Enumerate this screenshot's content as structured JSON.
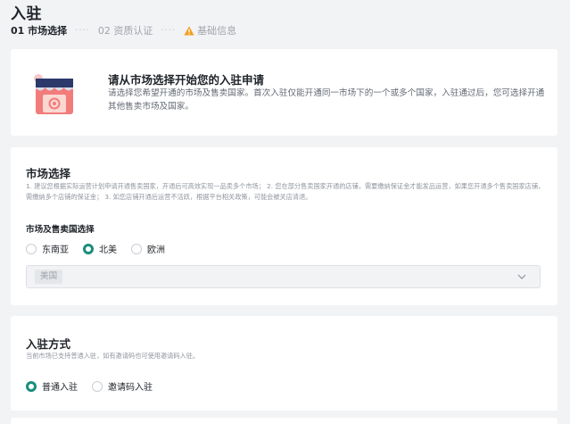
{
  "page": {
    "title": "入驻"
  },
  "steps": {
    "step1": "01 市场选择",
    "dots": "····",
    "step2": "02 资质认证",
    "step3": "基础信息"
  },
  "intro": {
    "icon": "shop-icon",
    "title": "请从市场选择开始您的入驻申请",
    "description": "请选择您希望开通的市场及售卖国家。首次入驻仅能开通同一市场下的一个或多个国家，入驻通过后，您可选择开通其他售卖市场及国家。"
  },
  "market": {
    "title": "市场选择",
    "description": "1. 建议您根据实际运营计划申请开通售卖国家，开通后可高效实现一品卖多个市场；  2. 您在部分售卖国家开通的店铺，需要缴纳保证金才能发品运营，如果您开通多个售卖国家店铺，需缴纳多个店铺的保证金；  3. 如您店铺开通后运营不活跃，根据平台相关政策，可能会被关店清退。",
    "field_label": "市场及售卖国选择",
    "options": [
      "东南亚",
      "北美",
      "欧洲"
    ],
    "selected_option": "北美",
    "selected_country": "美国"
  },
  "method": {
    "title": "入驻方式",
    "description": "当前市场已支持普通入驻，如有邀请码也可使用邀请码入驻。",
    "options": [
      "普通入驻",
      "邀请码入驻"
    ],
    "selected_option": "普通入驻"
  },
  "colors": {
    "accent": "#1a8e7d",
    "warning": "#f0a020",
    "background": "#f2f3f5"
  }
}
